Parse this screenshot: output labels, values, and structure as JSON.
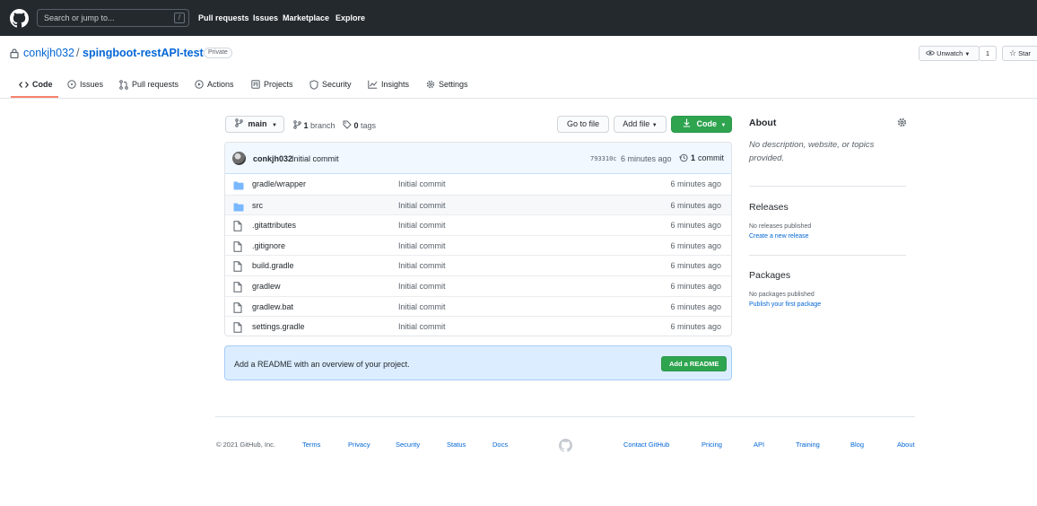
{
  "header": {
    "search_placeholder": "Search or jump to...",
    "search_shortcut": "/",
    "nav": [
      "Pull requests",
      "Issues",
      "Marketplace",
      "Explore"
    ]
  },
  "repo": {
    "owner": "conkjh032",
    "separator": "/",
    "name": "spingboot-restAPI-test",
    "visibility": "Private",
    "watch_label": "Unwatch",
    "watch_count": "1",
    "star_label": "Star"
  },
  "tabs": [
    {
      "label": "Code",
      "icon": "code-icon"
    },
    {
      "label": "Issues",
      "icon": "issue-icon"
    },
    {
      "label": "Pull requests",
      "icon": "pull-request-icon"
    },
    {
      "label": "Actions",
      "icon": "play-icon"
    },
    {
      "label": "Projects",
      "icon": "project-icon"
    },
    {
      "label": "Security",
      "icon": "shield-icon"
    },
    {
      "label": "Insights",
      "icon": "graph-icon"
    },
    {
      "label": "Settings",
      "icon": "gear-icon"
    }
  ],
  "branch_bar": {
    "branch": "main",
    "branch_count": "1",
    "branch_word": "branch",
    "tag_count": "0",
    "tag_word": "tags",
    "go_to_file": "Go to file",
    "add_file": "Add file",
    "code": "Code"
  },
  "commit": {
    "author": "conkjh032",
    "message": "Initial commit",
    "sha": "793310c",
    "time": "6 minutes ago",
    "count": "1",
    "count_word": "commit"
  },
  "files": [
    {
      "name": "gradle/wrapper",
      "type": "folder",
      "commit": "Initial commit",
      "age": "6 minutes ago"
    },
    {
      "name": "src",
      "type": "folder",
      "commit": "Initial commit",
      "age": "6 minutes ago"
    },
    {
      "name": ".gitattributes",
      "type": "file",
      "commit": "Initial commit",
      "age": "6 minutes ago"
    },
    {
      "name": ".gitignore",
      "type": "file",
      "commit": "Initial commit",
      "age": "6 minutes ago"
    },
    {
      "name": "build.gradle",
      "type": "file",
      "commit": "Initial commit",
      "age": "6 minutes ago"
    },
    {
      "name": "gradlew",
      "type": "file",
      "commit": "Initial commit",
      "age": "6 minutes ago"
    },
    {
      "name": "gradlew.bat",
      "type": "file",
      "commit": "Initial commit",
      "age": "6 minutes ago"
    },
    {
      "name": "settings.gradle",
      "type": "file",
      "commit": "Initial commit",
      "age": "6 minutes ago"
    }
  ],
  "readme": {
    "text": "Add a README with an overview of your project.",
    "button": "Add a README"
  },
  "sidebar": {
    "about_title": "About",
    "about_desc": "No description, website, or topics provided.",
    "releases_title": "Releases",
    "releases_none": "No releases published",
    "releases_link": "Create a new release",
    "packages_title": "Packages",
    "packages_none": "No packages published",
    "packages_link": "Publish your first package"
  },
  "footer": {
    "copyright": "© 2021 GitHub, Inc.",
    "links": [
      "Terms",
      "Privacy",
      "Security",
      "Status",
      "Docs",
      "Contact GitHub",
      "Pricing",
      "API",
      "Training",
      "Blog",
      "About"
    ]
  },
  "colors": {
    "header_bg": "#24292e",
    "link": "#0366d6",
    "primary": "#2ea44f",
    "tab_underline": "#f9826c",
    "folder": "#79b8ff"
  }
}
